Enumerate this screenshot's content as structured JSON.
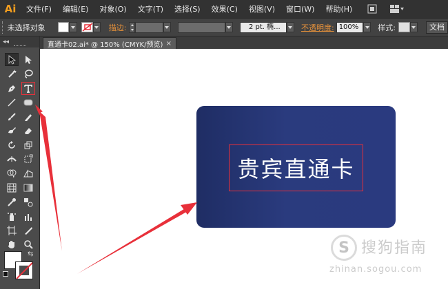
{
  "app": {
    "logo": "Ai"
  },
  "menu": {
    "items": [
      "文件(F)",
      "编辑(E)",
      "对象(O)",
      "文字(T)",
      "选择(S)",
      "效果(C)",
      "视图(V)",
      "窗口(W)",
      "帮助(H)"
    ]
  },
  "controlbar": {
    "selection_label": "未选择对象",
    "stroke_label": "描边:",
    "brush_value": "2 pt. 椭...",
    "opacity_label": "不透明度:",
    "opacity_value": "100%",
    "style_label": "样式:",
    "doc_setup_label": "文档"
  },
  "document": {
    "tab_title": "直通卡02.ai* @ 150% (CMYK/预览)",
    "close_glyph": "×"
  },
  "card": {
    "text": "贵宾直通卡"
  },
  "tools": {
    "panel_collapse": "◂◂",
    "swap_glyph": "⇆"
  },
  "watermark": {
    "logo_glyph": "S",
    "name": "搜狗指南",
    "url": "zhinan.sogou.com"
  },
  "colors": {
    "card_start": "#1f2d64",
    "card_end": "#2a3a7f",
    "highlight_red": "#e8303a",
    "ai_orange": "#f29d1f"
  }
}
